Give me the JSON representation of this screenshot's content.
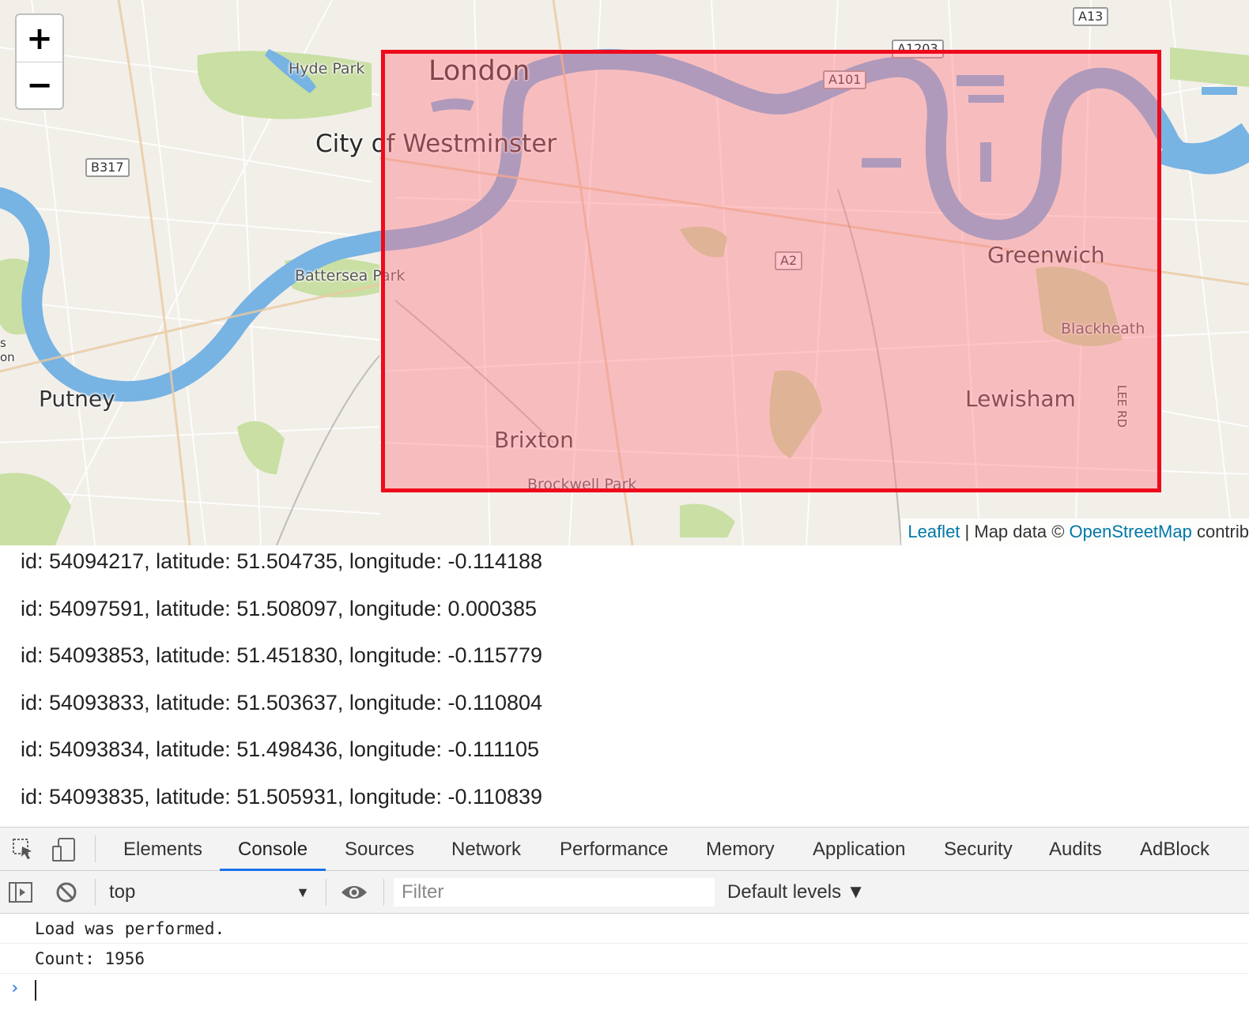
{
  "map": {
    "zoom_in_label": "+",
    "zoom_out_label": "−",
    "labels": {
      "london": "London",
      "westminster": "City of Westminster",
      "hyde_park": "Hyde Park",
      "battersea_park": "Battersea Park",
      "putney": "Putney",
      "brixton": "Brixton",
      "brockwell_park": "Brockwell Park",
      "greenwich": "Greenwich",
      "blackheath": "Blackheath",
      "lewisham": "Lewisham",
      "lee_rd": "LEE RD",
      "edge_s": "s",
      "edge_on": "on"
    },
    "road_shields": {
      "b317": "B317",
      "a101": "A101",
      "a1203": "A1203",
      "a13": "A13",
      "a2": "A2"
    },
    "attribution": {
      "leaflet": "Leaflet",
      "separator": " | Map data © ",
      "osm": "OpenStreetMap",
      "tail": " contrib"
    },
    "colors": {
      "land": "#f2efe9",
      "water": "#77b3e3",
      "park": "#c9dfa3",
      "bbox_stroke": "#ee0a1c",
      "bbox_fill": "#ff7882"
    }
  },
  "results": [
    "id: 54094217, latitude: 51.504735, longitude: -0.114188",
    "id: 54097591, latitude: 51.508097, longitude: 0.000385",
    "id: 54093853, latitude: 51.451830, longitude: -0.115779",
    "id: 54093833, latitude: 51.503637, longitude: -0.110804",
    "id: 54093834, latitude: 51.498436, longitude: -0.111105",
    "id: 54093835, latitude: 51.505931, longitude: -0.110839"
  ],
  "devtools": {
    "tabs": [
      "Elements",
      "Console",
      "Sources",
      "Network",
      "Performance",
      "Memory",
      "Application",
      "Security",
      "Audits",
      "AdBlock"
    ],
    "active_tab": "Console",
    "context": "top",
    "filter_placeholder": "Filter",
    "levels": "Default levels ▼",
    "console_lines": [
      "Load was performed.",
      "Count: 1956"
    ],
    "prompt": "›",
    "icons": [
      "inspect-element-icon",
      "device-toolbar-icon",
      "sidebar-toggle-icon",
      "clear-console-icon",
      "eye-icon"
    ]
  }
}
